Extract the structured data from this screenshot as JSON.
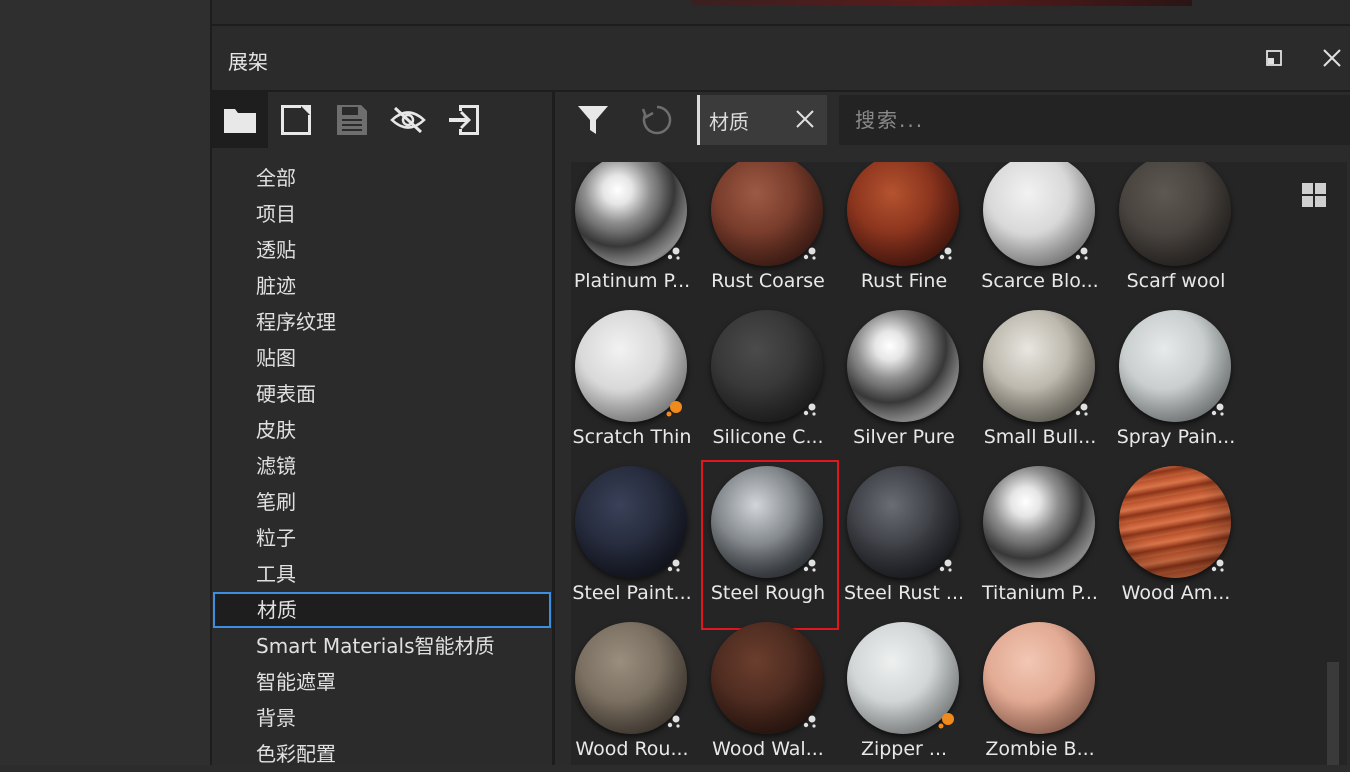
{
  "panel": {
    "title": "展架"
  },
  "tree_toolbar": [
    "folder-icon",
    "new-document-icon",
    "save-icon",
    "hide-icon",
    "import-icon"
  ],
  "categories": [
    "全部",
    "项目",
    "透贴",
    "脏迹",
    "程序纹理",
    "贴图",
    "硬表面",
    "皮肤",
    "滤镜",
    "笔刷",
    "粒子",
    "工具",
    "材质",
    "Smart Materials智能材质",
    "智能遮罩",
    "背景",
    "色彩配置"
  ],
  "selected_category": "材质",
  "filter": {
    "chip_label": "材质",
    "search_placeholder": "搜索..."
  },
  "assets": [
    {
      "label": "Platinum P...",
      "badge": "substance"
    },
    {
      "label": "Rust Coarse",
      "badge": "substance"
    },
    {
      "label": "Rust Fine",
      "badge": "substance"
    },
    {
      "label": "Scarce Blo...",
      "badge": "substance"
    },
    {
      "label": "Scarf wool",
      "badge": "none"
    },
    {
      "label": "Scratch Thin",
      "badge": "procedural"
    },
    {
      "label": "Silicone C...",
      "badge": "substance"
    },
    {
      "label": "Silver Pure",
      "badge": "none"
    },
    {
      "label": "Small Bull...",
      "badge": "substance"
    },
    {
      "label": "Spray Pain...",
      "badge": "substance"
    },
    {
      "label": "Steel Paint...",
      "badge": "substance"
    },
    {
      "label": "Steel Rough",
      "badge": "substance"
    },
    {
      "label": "Steel Rust ...",
      "badge": "substance"
    },
    {
      "label": "Titanium P...",
      "badge": "none"
    },
    {
      "label": "Wood Am...",
      "badge": "substance"
    },
    {
      "label": "Wood Rou...",
      "badge": "substance"
    },
    {
      "label": "Wood Wal...",
      "badge": "substance"
    },
    {
      "label": "Zipper ...",
      "badge": "procedural"
    },
    {
      "label": "Zombie B...",
      "badge": "none"
    }
  ],
  "highlighted_asset": "Steel Rough",
  "colors": {
    "highlight": "#e0171d",
    "selection": "#3d8ee0",
    "procedural_badge": "#f08a1c"
  }
}
